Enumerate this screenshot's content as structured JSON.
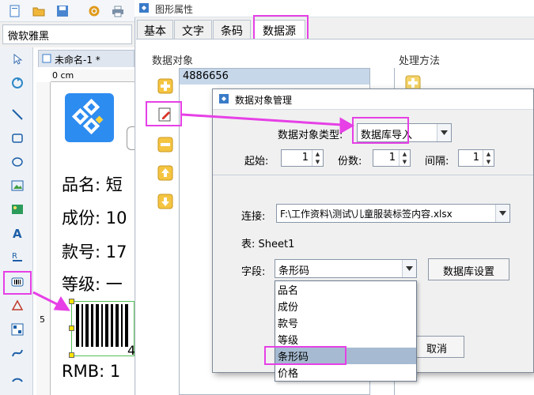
{
  "app": {
    "font_name": "微软雅黑",
    "doc_tab": "未命名-1 *",
    "ruler_unit": "0 cm",
    "ruler_left_mark": "5"
  },
  "label_content": {
    "lines": [
      "品名: 短",
      "成份: 10",
      "款号: 17",
      "等级: 一",
      "RMB: 1"
    ],
    "barcode_digit": "4"
  },
  "properties_window": {
    "title": "图形属性",
    "tabs": [
      "基本",
      "文字",
      "条码",
      "数据源"
    ],
    "data_objects_label": "数据对象",
    "processing_label": "处理方法",
    "data_object_value": "4886656"
  },
  "dialog": {
    "title": "数据对象管理",
    "type_label": "数据对象类型:",
    "type_value": "数据库导入",
    "start_label": "起始:",
    "start_value": "1",
    "copies_label": "份数:",
    "copies_value": "1",
    "interval_label": "间隔:",
    "interval_value": "1",
    "connection_label": "连接:",
    "connection_value": "F:\\工作资料\\测试\\儿童服装标签内容.xlsx",
    "table_label": "表: Sheet1",
    "field_label": "字段:",
    "field_value": "条形码",
    "db_settings_button": "数据库设置",
    "cancel_button": "取消",
    "field_options": [
      "品名",
      "成份",
      "款号",
      "等级",
      "条形码",
      "价格"
    ]
  },
  "colors": {
    "highlight": "#e640e6",
    "selection": "#a6bbd1",
    "list_selection": "#c7d7ea"
  }
}
